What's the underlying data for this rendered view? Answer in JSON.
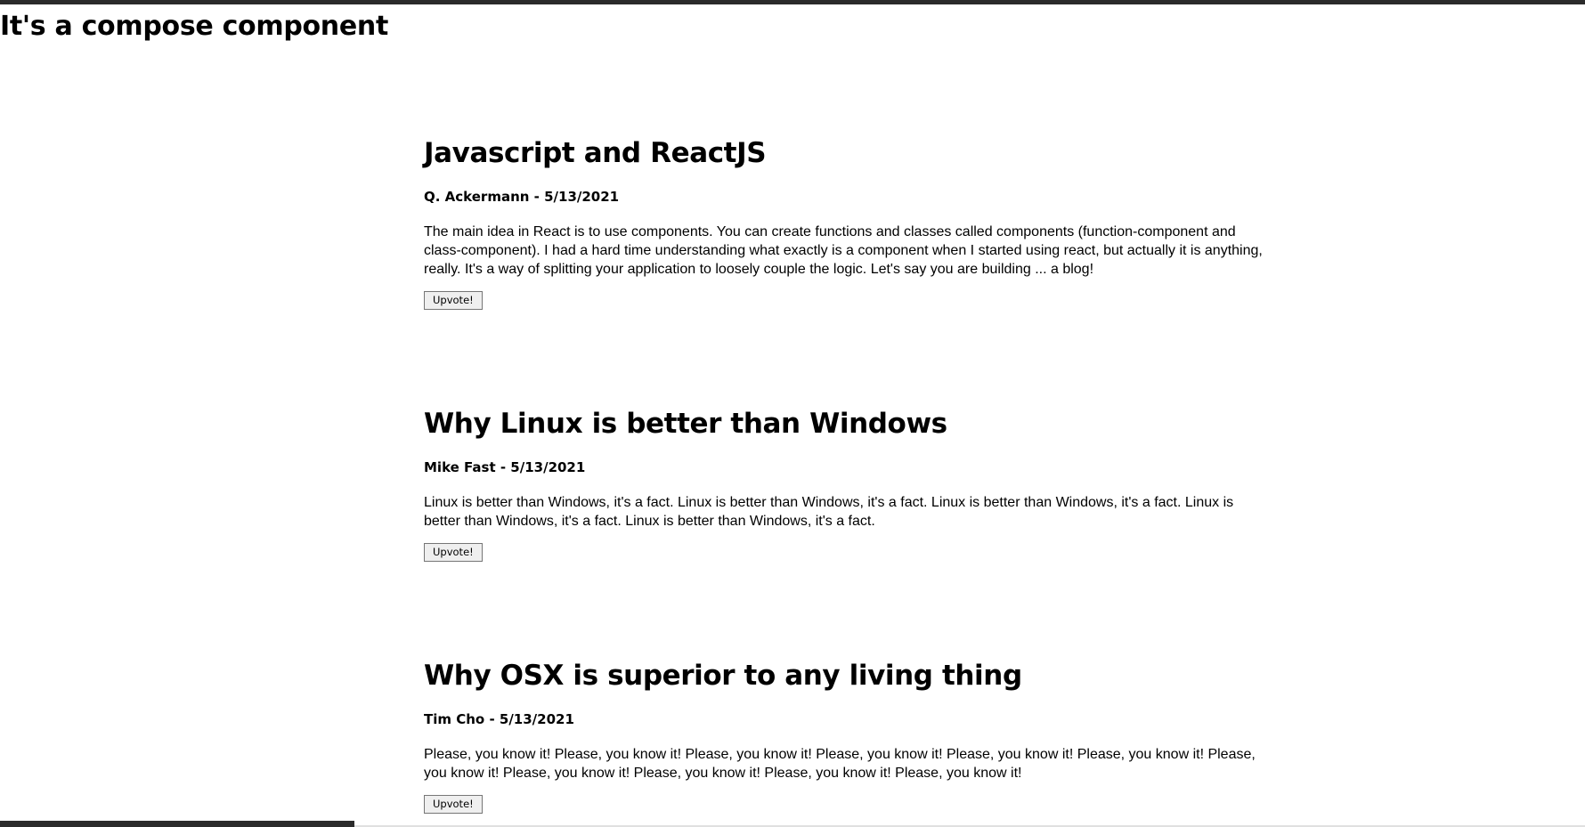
{
  "page": {
    "title": "It's a compose component"
  },
  "posts": [
    {
      "title": "Javascript and ReactJS",
      "meta": "Q. Ackermann - 5/13/2021",
      "body": "The main idea in React is to use components. You can create functions and classes called components (function-component and class-component). I had a hard time understanding what exactly is a component when I started using react, but actually it is anything, really. It's a way of splitting your application to loosely couple the logic. Let's say you are building ... a blog!",
      "button_label": "Upvote!"
    },
    {
      "title": "Why Linux is better than Windows",
      "meta": "Mike Fast - 5/13/2021",
      "body": "Linux is better than Windows, it's a fact. Linux is better than Windows, it's a fact. Linux is better than Windows, it's a fact. Linux is better than Windows, it's a fact. Linux is better than Windows, it's a fact.",
      "button_label": "Upvote!"
    },
    {
      "title": "Why OSX is superior to any living thing",
      "meta": "Tim Cho - 5/13/2021",
      "body": "Please, you know it! Please, you know it! Please, you know it! Please, you know it! Please, you know it! Please, you know it! Please, you know it! Please, you know it! Please, you know it! Please, you know it! Please, you know it!",
      "button_label": "Upvote!"
    }
  ]
}
